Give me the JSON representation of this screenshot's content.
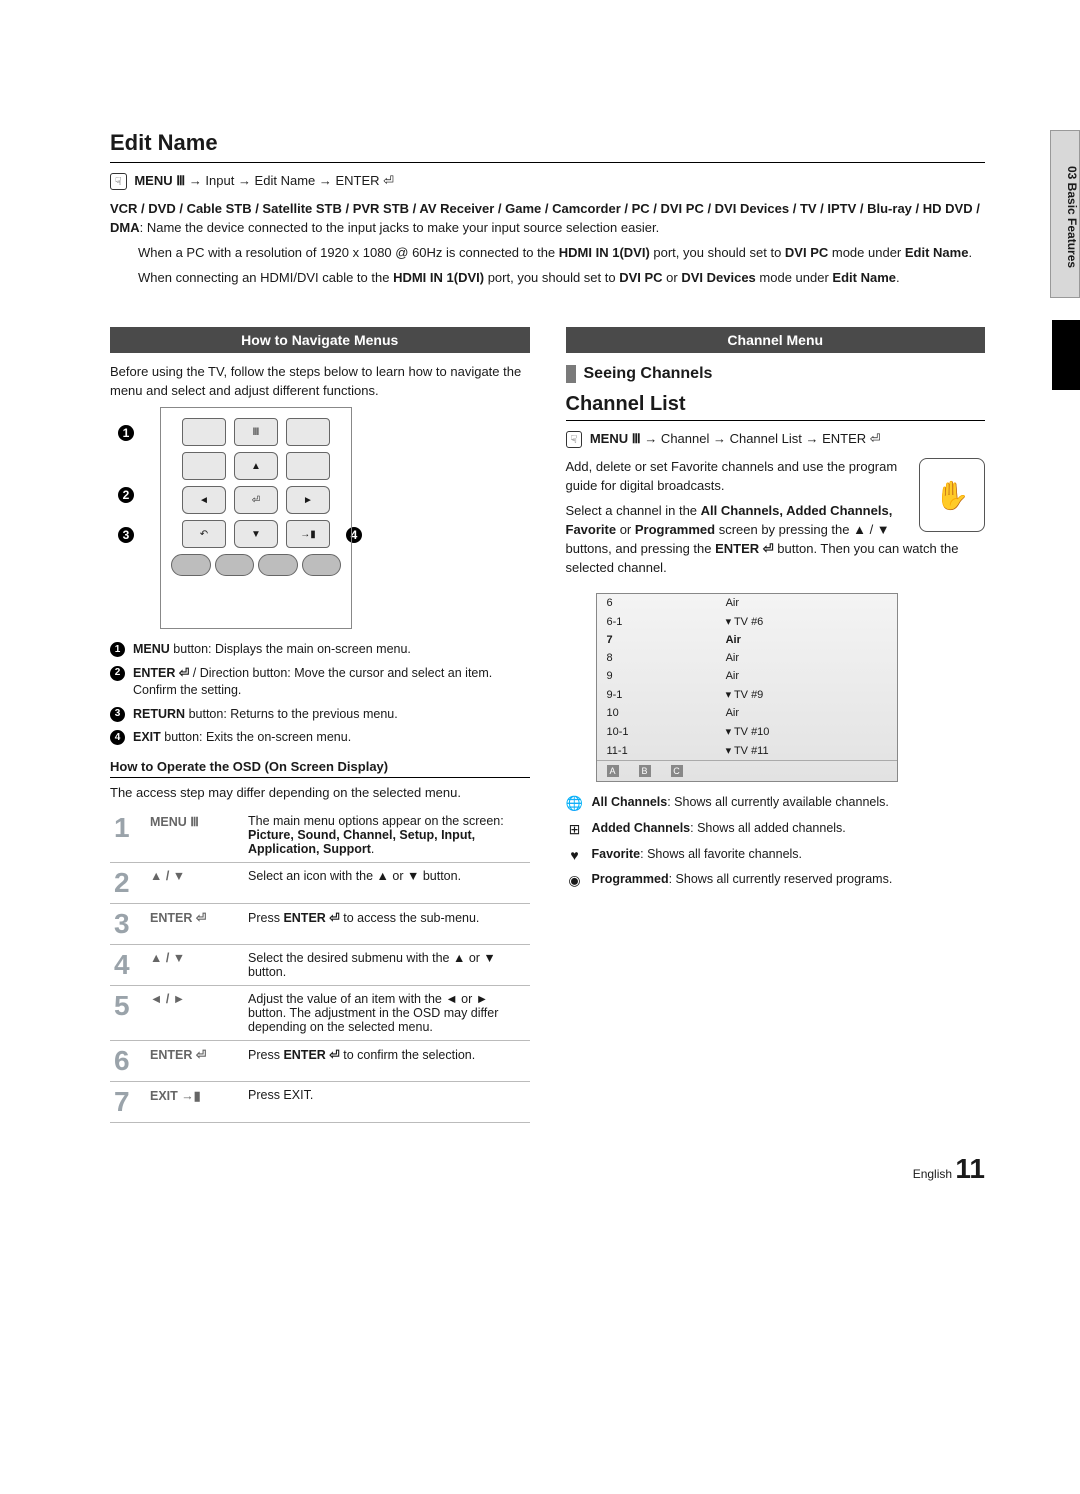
{
  "side_tab": "03  Basic Features",
  "edit_name": {
    "title": "Edit Name",
    "breadcrumb_label_menu": "MENU",
    "breadcrumb_path": " → Input → Edit Name → ENTER",
    "devices_bold": "VCR / DVD / Cable STB / Satellite STB / PVR STB / AV Receiver / Game / Camcorder / PC / DVI PC / DVI Devices / TV / IPTV / Blu-ray / HD DVD / DMA",
    "devices_rest": ": Name the device connected to the input jacks to make your input source selection easier.",
    "note1_a": "When a PC with a resolution of 1920 x 1080 @ 60Hz is connected to the ",
    "note1_b": "HDMI IN 1(DVI)",
    "note1_c": " port, you should set to ",
    "note1_d": "DVI PC",
    "note1_e": " mode under ",
    "note1_f": "Edit Name",
    "note1_g": ".",
    "note2_a": "When connecting an HDMI/DVI cable to the ",
    "note2_b": "HDMI IN 1(DVI)",
    "note2_c": " port, you should set to ",
    "note2_d": "DVI PC",
    "note2_e": " or ",
    "note2_f": "DVI Devices",
    "note2_g": " mode under ",
    "note2_h": "Edit Name",
    "note2_i": "."
  },
  "left": {
    "header": "How to Navigate Menus",
    "intro": "Before using the TV, follow the steps below to learn how to navigate the menu and select and adjust different functions.",
    "callouts": {
      "c1": "1",
      "c2": "2",
      "c3": "3",
      "c4": "4"
    },
    "buttons_desc": [
      {
        "n": "1",
        "bold": "MENU",
        "text": " button: Displays the main on-screen menu."
      },
      {
        "n": "2",
        "bold": "ENTER",
        "text": " / Direction button: Move the cursor and select an item. Confirm the setting."
      },
      {
        "n": "3",
        "bold": "RETURN",
        "text": " button: Returns to the previous menu."
      },
      {
        "n": "4",
        "bold": "EXIT",
        "text": " button: Exits the on-screen menu."
      }
    ],
    "osd_head": "How to Operate the OSD (On Screen Display)",
    "osd_note": "The access step may differ depending on the selected menu.",
    "osd_steps": [
      {
        "n": "1",
        "ctrl": "MENU Ⅲ",
        "desc_a": "The main menu options appear on the screen:",
        "desc_b": "Picture, Sound, Channel, Setup, Input, Application, Support",
        "desc_c": "."
      },
      {
        "n": "2",
        "ctrl": "▲ / ▼",
        "desc_a": "Select an icon with the ▲ or ▼ button.",
        "desc_b": "",
        "desc_c": ""
      },
      {
        "n": "3",
        "ctrl": "ENTER ⏎",
        "desc_a": "Press ",
        "desc_b": "ENTER ⏎",
        "desc_c": " to access the sub-menu."
      },
      {
        "n": "4",
        "ctrl": "▲ / ▼",
        "desc_a": "Select the desired submenu with the ▲ or ▼ button.",
        "desc_b": "",
        "desc_c": ""
      },
      {
        "n": "5",
        "ctrl": "◄ / ►",
        "desc_a": "Adjust the value of an item with the ◄ or ► button. The adjustment in the OSD may differ depending on the selected menu.",
        "desc_b": "",
        "desc_c": ""
      },
      {
        "n": "6",
        "ctrl": "ENTER ⏎",
        "desc_a": "Press ",
        "desc_b": "ENTER ⏎",
        "desc_c": " to confirm the selection."
      },
      {
        "n": "7",
        "ctrl": "EXIT →▮",
        "desc_a": "Press EXIT.",
        "desc_b": "",
        "desc_c": ""
      }
    ]
  },
  "right": {
    "header": "Channel Menu",
    "seeing": "Seeing Channels",
    "channel_list_title": "Channel List",
    "breadcrumb_label_menu": "MENU",
    "breadcrumb_path": " → Channel → Channel List → ENTER",
    "desc_a": "Add, delete or set Favorite channels and use the program guide for digital broadcasts.",
    "desc_b_a": "Select a channel in the ",
    "desc_b_b": "All Channels, Added Channels, Favorite",
    "desc_b_c": " or ",
    "desc_b_d": "Programmed",
    "desc_b_e": " screen by pressing the ▲ / ▼ buttons, and pressing the ",
    "desc_b_f": "ENTER ⏎",
    "desc_b_g": " button. Then you can watch the selected channel.",
    "channel_rows": [
      {
        "ch": "6",
        "name": "Air"
      },
      {
        "ch": "6-1",
        "name": "▾ TV #6"
      },
      {
        "ch": "7",
        "name": "Air",
        "sel": true
      },
      {
        "ch": "8",
        "name": "Air"
      },
      {
        "ch": "9",
        "name": "Air"
      },
      {
        "ch": "9-1",
        "name": "▾ TV #9"
      },
      {
        "ch": "10",
        "name": "Air"
      },
      {
        "ch": "10-1",
        "name": "▾ TV #10"
      },
      {
        "ch": "11-1",
        "name": "▾ TV #11"
      }
    ],
    "panel_footer": {
      "a": "A",
      "b": "B",
      "c": "C"
    },
    "legend": [
      {
        "icon": "🌐",
        "bold": "All Channels",
        "text": ": Shows all currently available channels."
      },
      {
        "icon": "⊞",
        "bold": "Added Channels",
        "text": ": Shows all added channels."
      },
      {
        "icon": "♥",
        "bold": "Favorite",
        "text": ": Shows all favorite channels."
      },
      {
        "icon": "◉",
        "bold": "Programmed",
        "text": ": Shows all currently reserved programs."
      }
    ]
  },
  "footer": {
    "lang": "English",
    "page": "11"
  }
}
